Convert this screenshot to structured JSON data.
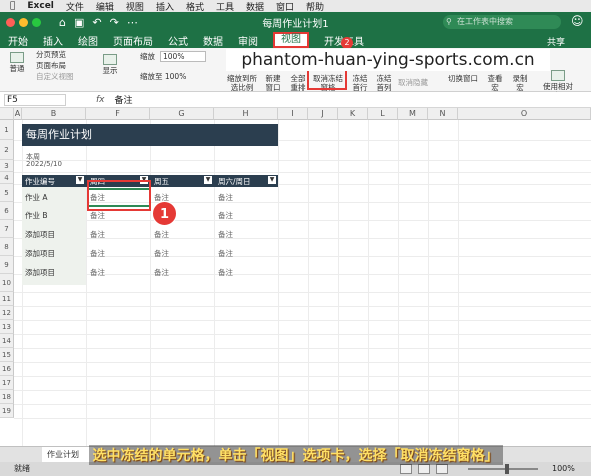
{
  "menubar": {
    "app": "Excel",
    "items": [
      "文件",
      "编辑",
      "视图",
      "插入",
      "格式",
      "工具",
      "数据",
      "窗口",
      "帮助"
    ]
  },
  "window": {
    "title": "每周作业计划1",
    "search_placeholder": "在工作表中搜索",
    "share": "共享"
  },
  "tabs": [
    "开始",
    "插入",
    "绘图",
    "页面布局",
    "公式",
    "数据",
    "审阅",
    "视图",
    "开发工具"
  ],
  "active_tab": "视图",
  "ribbon": {
    "normal": "普通",
    "page_break": "分页预览",
    "page_layout": "页面布局",
    "custom": "自定义视图",
    "show": "显示",
    "zoom": "缩放",
    "zoom_value": "100%",
    "zoom_100": "缩放至 100%",
    "zoom_sel": "缩放到所选比例",
    "new_window": "新建窗口",
    "arrange_all": "全部重排",
    "unfreeze": "取消冻结窗格",
    "freeze_top": "冻结首行",
    "freeze_col": "冻结首列",
    "hide": "取消隐藏",
    "switch": "切换窗口",
    "macros_view": "查看宏",
    "record": "录制宏",
    "relative": "使用相对引用"
  },
  "watermark": "phantom-huan-ying-sports.com.cn",
  "markers": {
    "one": "1",
    "two": "2"
  },
  "formula": {
    "cell": "F5",
    "fx": "fx",
    "value": "备注"
  },
  "columns": [
    "A",
    "B",
    "E",
    "F",
    "G",
    "H",
    "I",
    "J",
    "K",
    "L",
    "M",
    "N",
    "O"
  ],
  "rows": [
    "1",
    "2",
    "3",
    "4",
    "5",
    "6",
    "7",
    "8",
    "9",
    "10",
    "11",
    "12",
    "13",
    "14",
    "15",
    "16",
    "17",
    "18",
    "19"
  ],
  "plan": {
    "title": "每周作业计划",
    "week_label": "本周",
    "date": "2022/5/10",
    "headers": [
      "作业编号",
      "周四",
      "周五",
      "周六/周日"
    ],
    "items": [
      {
        "name": "作业 A",
        "c1": "备注",
        "c2": "备注",
        "c3": "备注"
      },
      {
        "name": "作业 B",
        "c1": "备注",
        "c2": "备注",
        "c3": "备注"
      },
      {
        "name": "添加项目",
        "c1": "备注",
        "c2": "备注",
        "c3": "备注"
      },
      {
        "name": "添加项目",
        "c1": "备注",
        "c2": "备注",
        "c3": "备注"
      },
      {
        "name": "添加项目",
        "c1": "备注",
        "c2": "备注",
        "c3": "备注"
      }
    ]
  },
  "sheet_tab": "作业计划",
  "status": {
    "ready": "就绪",
    "zoom": "100%"
  },
  "caption": "选中冻结的单元格，单击「视图」选项卡，选择「取消冻结窗格」",
  "colors": {
    "excel_green": "#1e7145",
    "header_navy": "#2b3e4f",
    "highlight_red": "#e53935"
  }
}
